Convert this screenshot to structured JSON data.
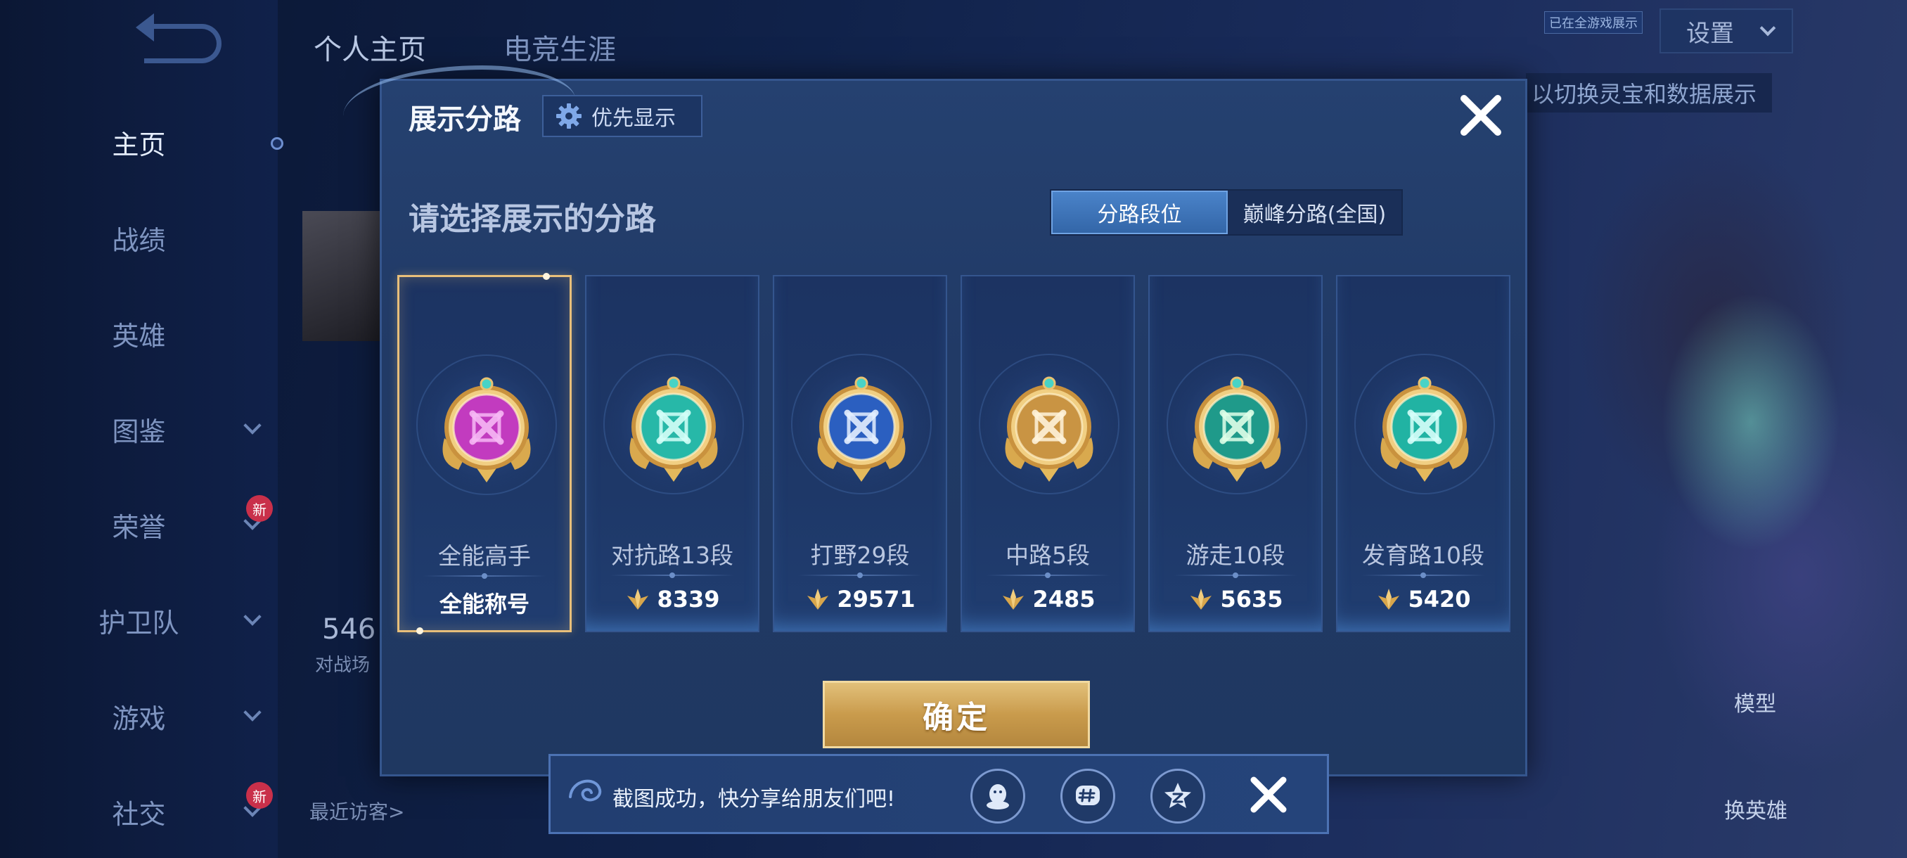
{
  "nav": {
    "items": [
      {
        "label": "主页",
        "active": true,
        "chevron": false,
        "new": false
      },
      {
        "label": "战绩",
        "active": false,
        "chevron": false,
        "new": false
      },
      {
        "label": "英雄",
        "active": false,
        "chevron": false,
        "new": false
      },
      {
        "label": "图鉴",
        "active": false,
        "chevron": true,
        "new": false
      },
      {
        "label": "荣誉",
        "active": false,
        "chevron": true,
        "new": true
      },
      {
        "label": "护卫队",
        "active": false,
        "chevron": true,
        "new": false
      },
      {
        "label": "游戏",
        "active": false,
        "chevron": true,
        "new": false
      },
      {
        "label": "社交",
        "active": false,
        "chevron": true,
        "new": true
      }
    ],
    "new_badge": "新"
  },
  "background": {
    "tabs": [
      "个人主页",
      "电竞生涯"
    ],
    "settings_label": "设置",
    "small_badge": "已在全游戏展示",
    "hint": "以切换灵宝和数据展示",
    "stat_number": "546",
    "stat_caption": "对战场",
    "visitors_label": "最近访客>",
    "model_label": "模型",
    "switch_hero_label": "换英雄"
  },
  "dialog": {
    "title": "展示分路",
    "priority_button": "优先显示",
    "subtitle": "请选择展示的分路",
    "segment": {
      "options": [
        "分路段位",
        "巅峰分路(全国)"
      ],
      "selected": 0
    },
    "lanes": [
      {
        "name": "全能高手",
        "value": "全能称号",
        "show_icon": false,
        "color": "#c23bbf",
        "accent": "#f7b8f5",
        "icon": "all-round-icon",
        "selected": true
      },
      {
        "name": "对抗路13段",
        "value": "8339",
        "show_icon": true,
        "color": "#27b8a8",
        "accent": "#d4fff8",
        "icon": "clash-lane-icon",
        "selected": false
      },
      {
        "name": "打野29段",
        "value": "29571",
        "show_icon": true,
        "color": "#2b5fc0",
        "accent": "#e4efff",
        "icon": "jungle-icon",
        "selected": false
      },
      {
        "name": "中路5段",
        "value": "2485",
        "show_icon": true,
        "color": "#c99443",
        "accent": "#fff3da",
        "icon": "mid-lane-icon",
        "selected": false
      },
      {
        "name": "游走10段",
        "value": "5635",
        "show_icon": true,
        "color": "#1f9a8a",
        "accent": "#dfffe9",
        "icon": "roam-icon",
        "selected": false
      },
      {
        "name": "发育路10段",
        "value": "5420",
        "show_icon": true,
        "color": "#21b3a3",
        "accent": "#d6fffa",
        "icon": "farm-lane-icon",
        "selected": false
      }
    ],
    "confirm_label": "确定"
  },
  "toast": {
    "message": "截图成功，快分享给朋友们吧!",
    "share_targets": [
      "qq-icon",
      "wechat-moments-icon",
      "qzone-icon"
    ]
  }
}
